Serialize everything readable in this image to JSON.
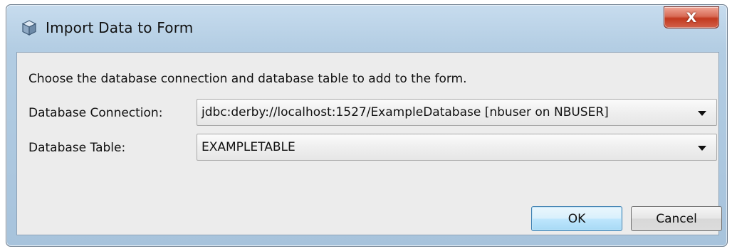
{
  "window": {
    "title": "Import Data to Form",
    "close_glyph": "X",
    "app_icon": "cube-icon"
  },
  "instruction": "Choose the database connection and database table to add to the form.",
  "connection": {
    "label": "Database Connection:",
    "selected": "jdbc:derby://localhost:1527/ExampleDatabase [nbuser on NBUSER]"
  },
  "table": {
    "label": "Database Table:",
    "selected": "EXAMPLETABLE"
  },
  "buttons": {
    "ok": "OK",
    "cancel": "Cancel"
  },
  "colors": {
    "titlebar": "#b3cde3",
    "client": "#ececec",
    "close": "#c2391f",
    "default_button_border": "#3c7fb1"
  }
}
